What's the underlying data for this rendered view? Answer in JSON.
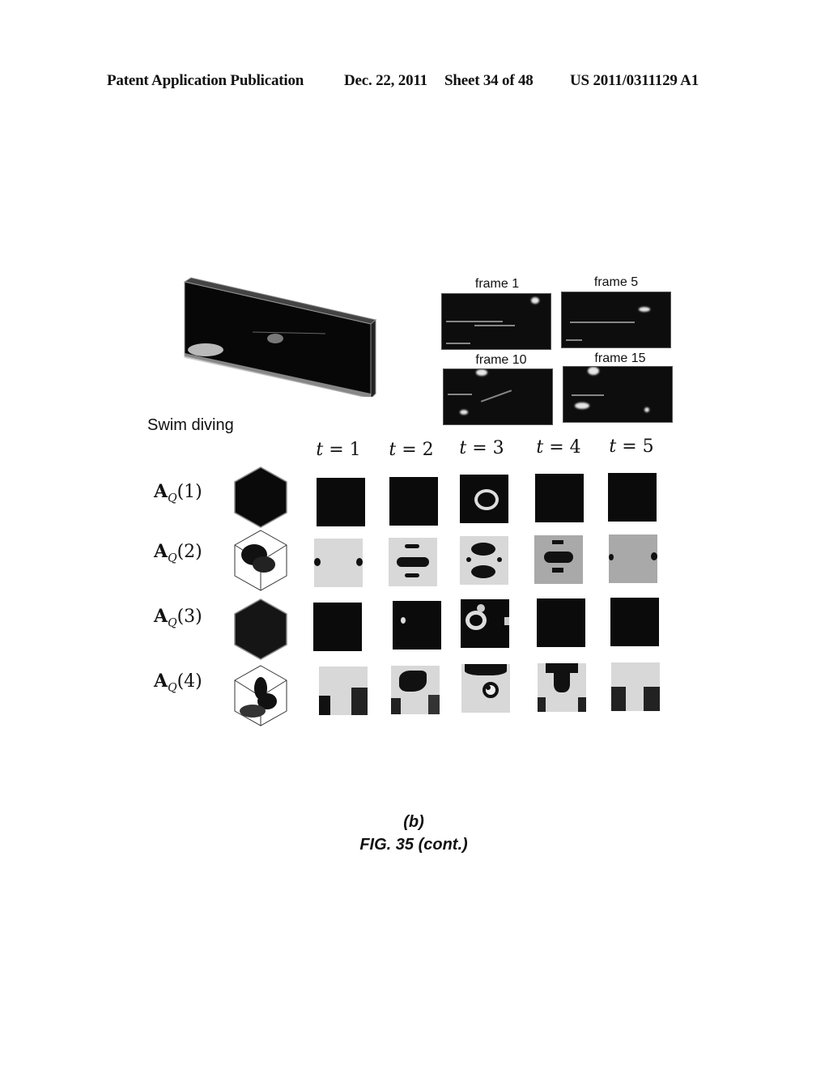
{
  "header": {
    "left": "Patent Application Publication",
    "date": "Dec. 22, 2011",
    "sheet": "Sheet 34 of 48",
    "number": "US 2011/0311129 A1"
  },
  "figure": {
    "video_title": "Swim diving",
    "frames": [
      {
        "label": "frame 1"
      },
      {
        "label": "frame 5"
      },
      {
        "label": "frame 10"
      },
      {
        "label": "frame 15"
      }
    ],
    "time_labels": [
      {
        "var": "t",
        "eq": " = ",
        "val": "1"
      },
      {
        "var": "t",
        "eq": " = ",
        "val": "2"
      },
      {
        "var": "t",
        "eq": " = ",
        "val": "3"
      },
      {
        "var": "t",
        "eq": " = ",
        "val": "4"
      },
      {
        "var": "t",
        "eq": " = ",
        "val": "5"
      }
    ],
    "rows": [
      {
        "symbol": "A",
        "sub": "Q",
        "index": "(1)",
        "cells": [
          "dark",
          "dark",
          "dark-ring",
          "dark",
          "dark"
        ]
      },
      {
        "symbol": "A",
        "sub": "Q",
        "index": "(2)",
        "cells": [
          "light-dots",
          "light-bars",
          "light-x",
          "gray-bars",
          "gray-dots"
        ]
      },
      {
        "symbol": "A",
        "sub": "Q",
        "index": "(3)",
        "cells": [
          "dark",
          "dark-spot",
          "dark-ring2",
          "dark",
          "dark"
        ]
      },
      {
        "symbol": "A",
        "sub": "Q",
        "index": "(4)",
        "cells": [
          "light-u",
          "light-blob",
          "light-ring",
          "light-t",
          "light-v"
        ]
      }
    ],
    "sub_caption": "(b)",
    "caption": "FIG. 35 (cont.)"
  }
}
